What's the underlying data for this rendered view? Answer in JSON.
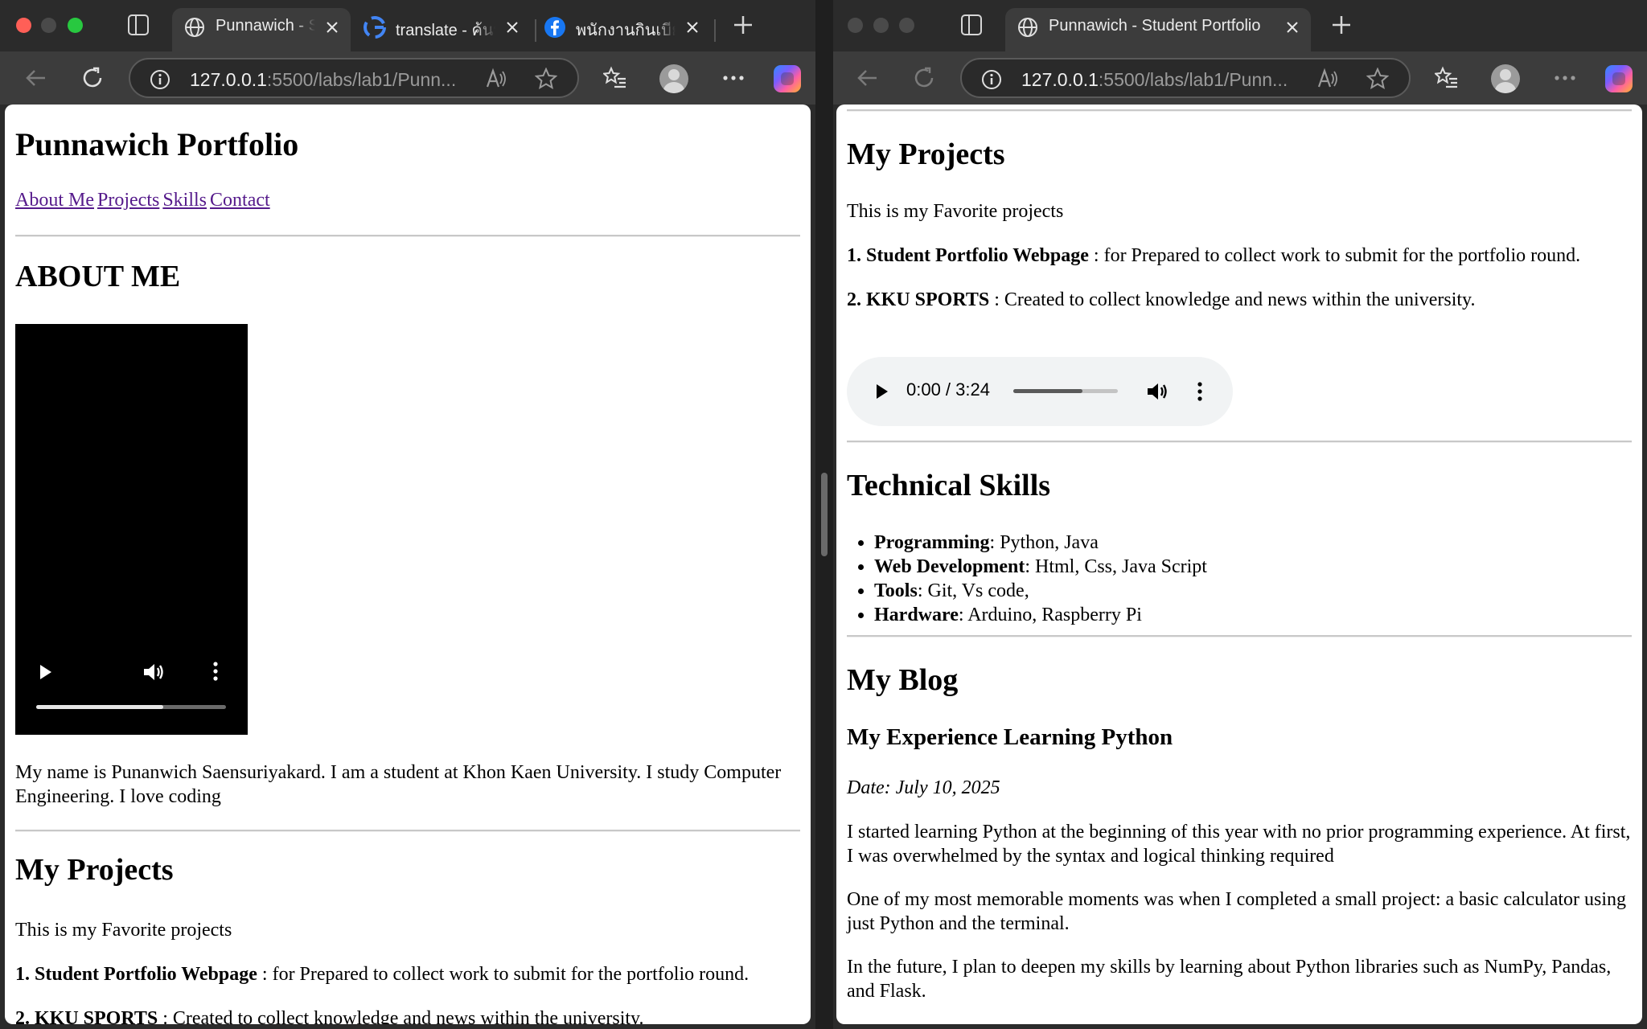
{
  "left": {
    "tabs": [
      {
        "title": "Punnawich - Student Portfolio",
        "icon": "globe-icon",
        "active": true
      },
      {
        "title": "translate - ค้นหาด้วย Google",
        "icon": "google-icon",
        "active": false
      },
      {
        "title": "พนักงานกินเบียร์",
        "icon": "facebook-icon",
        "active": false
      }
    ],
    "url_host": "127.0.0.1",
    "url_path": ":5500/labs/lab1/Punn..."
  },
  "right": {
    "tabs": [
      {
        "title": "Punnawich - Student Portfolio",
        "icon": "globe-icon",
        "active": true
      }
    ],
    "url_host": "127.0.0.1",
    "url_path": ":5500/labs/lab1/Punn..."
  },
  "page": {
    "site_title": "Punnawich Portfolio",
    "nav": [
      "About Me",
      "Projects",
      "Skills",
      "Contact"
    ],
    "about_heading": "ABOUT ME",
    "about_text": "My name is Punanwich Saensuriyakard. I am a student at Khon Kaen University. I study Computer Engineering. I love coding",
    "video_progress": 0.67,
    "projects_heading": "My Projects",
    "projects_intro": "This is my Favorite projects",
    "projects": [
      {
        "name": "1. Student Portfolio Webpage",
        "desc": " : for Prepared to collect work to submit for the portfolio round."
      },
      {
        "name": "2. KKU SPORTS",
        "desc": " : Created to collect knowledge and news within the university."
      }
    ],
    "audio_time": "0:00 / 3:24",
    "audio_progress": 0.66,
    "skills_heading": "Technical Skills",
    "skills": [
      {
        "name": "Programming",
        "value": ": Python, Java"
      },
      {
        "name": "Web Development",
        "value": ": Html, Css, Java Script"
      },
      {
        "name": "Tools",
        "value": ": Git, Vs code,"
      },
      {
        "name": "Hardware",
        "value": ": Arduino, Raspberry Pi"
      }
    ],
    "blog_heading": "My Blog",
    "blog_post_title": "My Experience Learning Python",
    "blog_date": "Date: July 10, 2025",
    "blog_paragraphs": [
      "I started learning Python at the beginning of this year with no prior programming experience. At first, I was overwhelmed by the syntax and logical thinking required",
      "One of my most memorable moments was when I completed a small project: a basic calculator using just Python and the terminal.",
      "In the future, I plan to deepen my skills by learning about Python libraries such as NumPy, Pandas, and Flask."
    ]
  }
}
